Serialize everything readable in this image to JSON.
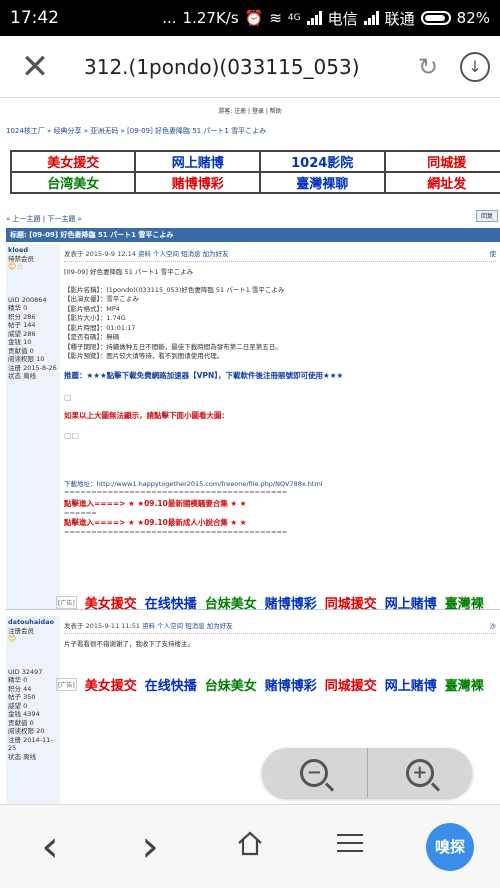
{
  "status": {
    "time": "17:42",
    "dots": "...",
    "speed": "1.27K/s",
    "net": "4G",
    "carrier1": "电信",
    "carrier2": "联通",
    "battery": "82%"
  },
  "browser": {
    "url": "312.(1pondo)(033115_053)"
  },
  "page": {
    "topnav": "游客: 注册 | 登录 | 帮助",
    "breadcrumb": "1024核工厂 » 经典分享 » 亚洲无码 » [09-09] 好色妻降臨 51 パート1 雪平こよみ",
    "ads": [
      [
        {
          "t": "美女援交",
          "c": "#e00000"
        },
        {
          "t": "网上赌博",
          "c": "#0030c0"
        },
        {
          "t": "1024影院",
          "c": "#0030c0"
        },
        {
          "t": "同城援",
          "c": "#e00000"
        }
      ],
      [
        {
          "t": "台湾美女",
          "c": "#008000"
        },
        {
          "t": "赌博博彩",
          "c": "#e00000"
        },
        {
          "t": "臺灣裸聊",
          "c": "#0030c0"
        },
        {
          "t": "網址发",
          "c": "#e00000"
        }
      ]
    ],
    "pager": "« 上一主題 | 下一主題 »",
    "reply_button": "回复",
    "thread_title": "标题: [09-09] 好色妻降臨 51 パート1 雪平こよみ",
    "post1": {
      "user": "kloed",
      "group": "待禁会员",
      "stars": "😊☆",
      "stats": [
        "UID 200864",
        "精华 0",
        "积分 286",
        "帖子 144",
        "威望 286",
        "金钱 10",
        "贡献值 0",
        "阅读权限 10",
        "注册 2015-8-26",
        "状态 离线"
      ],
      "meta": "发表于 2015-9-9 12:14",
      "meta_links": "资料  个人空间  短消息  加为好友",
      "floor": "使",
      "title": "[09-09] 好色妻降臨 51 パート1 雪平こよみ",
      "info": [
        "【影片名稱】：(1pondo)(033115_053)好色妻降臨 51 パート1 雪平こよみ",
        "【出演女優】：雪平こよみ",
        "【影片格式】：MP4",
        "【影片大小】：1.74G",
        "【影片時間】：01:01:17",
        "【是否有碼】：無碼",
        "【種子期限】：持續做种五日不間斷，最佳下載時間為發布第二日至第五日。",
        "【影片預覽】：图片较大请等待，看不到图请使用代理。"
      ],
      "recommend": "推薦：★★★點擊下載免費網路加速器【VPN】，下載軟件後注冊賬號即可使用★★★",
      "hint": "如果以上大圖無法顯示，請點擊下面小圖看大圖：",
      "download": "下載地址：http://www1.happytogether2015.com/freeone/file.php/NQV788x.html",
      "sep1": "=========================================",
      "enter1": "點擊進入====> ★ ★09.10最新國模騷妻合集 ★ ★",
      "sep2": "======",
      "enter2": "點擊進入====> ★ ★09.10最新成人小說合集 ★ ★",
      "sep3": "========================================="
    },
    "adrow": {
      "tag": "[广告]",
      "items": [
        {
          "t": "美女援交",
          "c": "#e00000"
        },
        {
          "t": "在线快播",
          "c": "#0030c0"
        },
        {
          "t": "台妹美女",
          "c": "#008000"
        },
        {
          "t": "赌博博彩",
          "c": "#0030c0"
        },
        {
          "t": "同城援交",
          "c": "#e00000"
        },
        {
          "t": "网上赌博",
          "c": "#0030c0"
        },
        {
          "t": "臺灣裸",
          "c": "#008000"
        }
      ]
    },
    "post2": {
      "user": "datouhaidao",
      "group": "注册会员",
      "stars": "😊",
      "stats": [
        "UID 32497",
        "精华 0",
        "积分 44",
        "帖子 350",
        "威望 0",
        "金钱 4394",
        "贡献值 0",
        "阅读权限 20",
        "注册 2014-11-25",
        "状态 离线"
      ],
      "meta": "发表于 2015-9-11 11:51",
      "meta_links": "资料  个人空间  短消息  加为好友",
      "floor": "沙",
      "text": "片子看看很不错谢谢了，我收下了支持楼主。"
    }
  },
  "zoom": {
    "out": "−",
    "in": "+"
  },
  "nav": {
    "back": "‹",
    "forward": "›",
    "search": "嗅探"
  }
}
